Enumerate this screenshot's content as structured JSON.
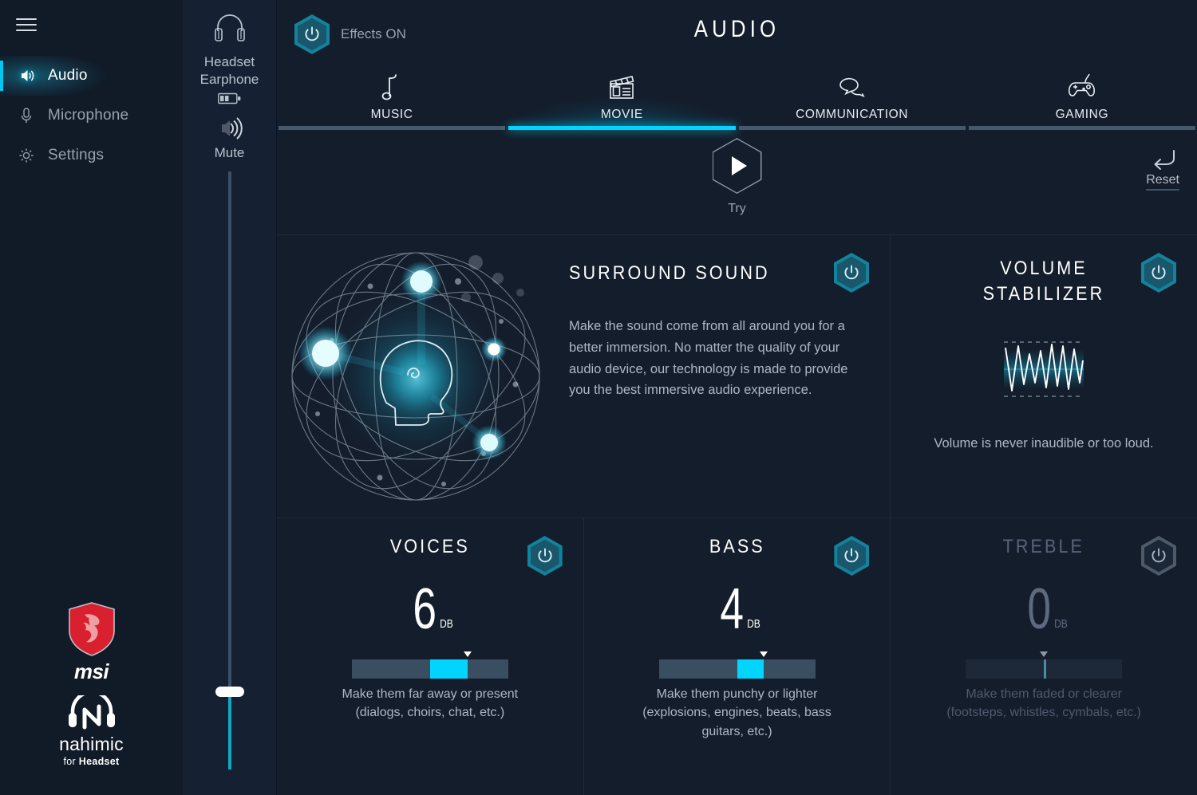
{
  "app": {
    "page_title": "AUDIO",
    "accent_color": "#00d5ff",
    "teal_color": "#13839d",
    "background": "#141d2b"
  },
  "sidebar": {
    "menu_icon": "hamburger-icon",
    "items": [
      {
        "label": "Audio",
        "icon": "speaker-waves-icon",
        "active": true
      },
      {
        "label": "Microphone",
        "icon": "microphone-icon",
        "active": false
      },
      {
        "label": "Settings",
        "icon": "gear-icon",
        "active": false
      }
    ],
    "brand_msi": "msi",
    "brand_nahimic": "nahimic",
    "brand_nahimic_sub_prefix": "for ",
    "brand_nahimic_sub_bold": "Headset"
  },
  "device": {
    "icon": "headset-icon",
    "name_line1": "Headset",
    "name_line2": "Earphone",
    "battery_icon": "battery-icon",
    "battery_level_bars": 2,
    "mute_icon": "speaker-waves-icon",
    "mute_label": "Mute",
    "volume_percent": 13
  },
  "header": {
    "effects_toggle_icon": "power-icon",
    "effects_label": "Effects ON",
    "effects_on": true
  },
  "tabs": [
    {
      "label": "MUSIC",
      "icon": "music-note-icon",
      "active": false
    },
    {
      "label": "MOVIE",
      "icon": "clapperboard-icon",
      "active": true
    },
    {
      "label": "COMMUNICATION",
      "icon": "speech-bubbles-icon",
      "active": false
    },
    {
      "label": "GAMING",
      "icon": "gamepad-icon",
      "active": false
    }
  ],
  "actions": {
    "try_label": "Try",
    "try_icon": "play-icon",
    "reset_label": "Reset",
    "reset_icon": "undo-arrow-icon"
  },
  "effects": {
    "surround": {
      "title": "SURROUND SOUND",
      "description": "Make the sound come from all around you for a better immersion. No matter the quality of your audio device, our technology is made to provide you the best immersive audio experience.",
      "toggle_icon": "power-icon",
      "enabled": true,
      "illustration": "surround-sphere-head-icon"
    },
    "volume_stabilizer": {
      "title_line1": "VOLUME",
      "title_line2": "STABILIZER",
      "description": "Volume is never inaudible or too loud.",
      "toggle_icon": "power-icon",
      "enabled": true,
      "illustration": "waveform-icon"
    }
  },
  "equalizer": [
    {
      "title": "VOICES",
      "value": "6",
      "unit": "DB",
      "enabled": true,
      "toggle_icon": "power-icon",
      "slider_percent": 74,
      "fill_start_percent": 50,
      "fill_end_percent": 74,
      "description_line1": "Make them far away or present",
      "description_line2": "(dialogs, choirs, chat, etc.)"
    },
    {
      "title": "BASS",
      "value": "4",
      "unit": "DB",
      "enabled": true,
      "toggle_icon": "power-icon",
      "slider_percent": 67,
      "fill_start_percent": 50,
      "fill_end_percent": 67,
      "description_line1": "Make them punchy or lighter",
      "description_line2": "(explosions, engines, beats, bass guitars, etc.)"
    },
    {
      "title": "TREBLE",
      "value": "0",
      "unit": "DB",
      "enabled": false,
      "toggle_icon": "power-icon",
      "slider_percent": 50,
      "fill_start_percent": 50,
      "fill_end_percent": 50,
      "description_line1": "Make them faded or clearer",
      "description_line2": "(footsteps, whistles, cymbals, etc.)"
    }
  ]
}
